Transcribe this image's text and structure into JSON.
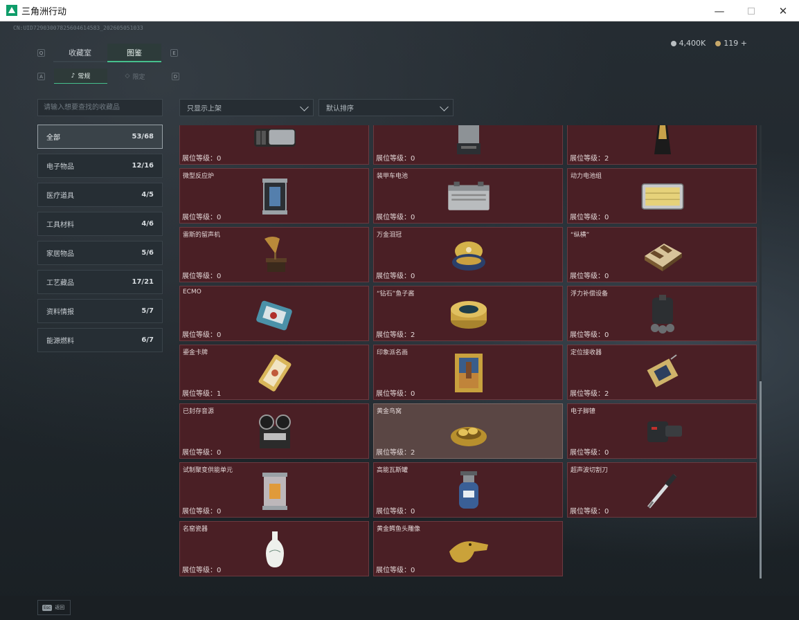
{
  "window": {
    "title": "三角洲行动",
    "minimize": "—",
    "close": "✕"
  },
  "uid": "CN:UID72903007825604614583_202605051033",
  "currency": {
    "silver": "4,400K",
    "gold": "119",
    "add": "+"
  },
  "tabs": {
    "left_key": "Q",
    "right_key": "E",
    "items": [
      {
        "label": "收藏室"
      },
      {
        "label": "图鉴"
      }
    ]
  },
  "subtabs": {
    "left_key": "A",
    "right_key": "D",
    "items": [
      {
        "label": "常规"
      },
      {
        "label": "限定"
      }
    ]
  },
  "search": {
    "placeholder": "请输入想要查找的收藏品"
  },
  "filters": {
    "shelf": "只显示上架",
    "sort": "默认排序"
  },
  "categories": [
    {
      "label": "全部",
      "count": "53/68"
    },
    {
      "label": "电子物品",
      "count": "12/16"
    },
    {
      "label": "医疗道具",
      "count": "4/5"
    },
    {
      "label": "工具材料",
      "count": "4/6"
    },
    {
      "label": "家居物品",
      "count": "5/6"
    },
    {
      "label": "工艺藏品",
      "count": "17/21"
    },
    {
      "label": "资料情报",
      "count": "5/7"
    },
    {
      "label": "能源燃料",
      "count": "6/7"
    }
  ],
  "items": [
    {
      "name": "",
      "level": "展位等级：0",
      "icon": "device-icon"
    },
    {
      "name": "",
      "level": "展位等级：0",
      "icon": "machine-icon"
    },
    {
      "name": "",
      "level": "展位等级：2",
      "icon": "artifact-icon"
    },
    {
      "name": "微型反应炉",
      "level": "展位等级：0",
      "icon": "reactor-icon"
    },
    {
      "name": "装甲车电池",
      "level": "展位等级：0",
      "icon": "battery-icon"
    },
    {
      "name": "动力电池组",
      "level": "展位等级：0",
      "icon": "battery-pack-icon"
    },
    {
      "name": "雷斯的留声机",
      "level": "展位等级：0",
      "icon": "gramophone-icon"
    },
    {
      "name": "万金泪冠",
      "level": "展位等级：0",
      "icon": "jeweled-egg-icon"
    },
    {
      "name": "“纵横”",
      "level": "展位等级：0",
      "icon": "chessboard-icon"
    },
    {
      "name": "ECMO",
      "level": "展位等级：0",
      "icon": "ecmo-icon"
    },
    {
      "name": "“钻石”鱼子酱",
      "level": "展位等级：2",
      "icon": "caviar-icon"
    },
    {
      "name": "浮力补偿设备",
      "level": "展位等级：0",
      "icon": "buoyancy-icon"
    },
    {
      "name": "鎏金卡牌",
      "level": "展位等级：1",
      "icon": "gold-card-icon"
    },
    {
      "name": "印象派名画",
      "level": "展位等级：0",
      "icon": "painting-icon"
    },
    {
      "name": "定位接收器",
      "level": "展位等级：2",
      "icon": "receiver-icon"
    },
    {
      "name": "已封存音源",
      "level": "展位等级：0",
      "icon": "reel-recorder-icon"
    },
    {
      "name": "黄金鸟窝",
      "level": "展位等级：2",
      "icon": "gold-nest-icon"
    },
    {
      "name": "电子脚镣",
      "level": "展位等级：0",
      "icon": "ankle-monitor-icon"
    },
    {
      "name": "试制聚变供能单元",
      "level": "展位等级：0",
      "icon": "fusion-unit-icon"
    },
    {
      "name": "高能瓦斯罐",
      "level": "展位等级：0",
      "icon": "gas-tank-icon"
    },
    {
      "name": "超声波切割刀",
      "level": "展位等级：0",
      "icon": "ultrasonic-knife-icon"
    },
    {
      "name": "名窑瓷器",
      "level": "展位等级：0",
      "icon": "porcelain-vase-icon"
    },
    {
      "name": "黄金鳄鱼头雕像",
      "level": "展位等级：0",
      "icon": "gold-croc-icon"
    }
  ],
  "bottom": {
    "esc_key": "Esc",
    "back_label": "返回"
  },
  "colors": {
    "accent": "#46c08d",
    "card_bg": "#4a1f25",
    "card_highlight": "#5a4644"
  }
}
